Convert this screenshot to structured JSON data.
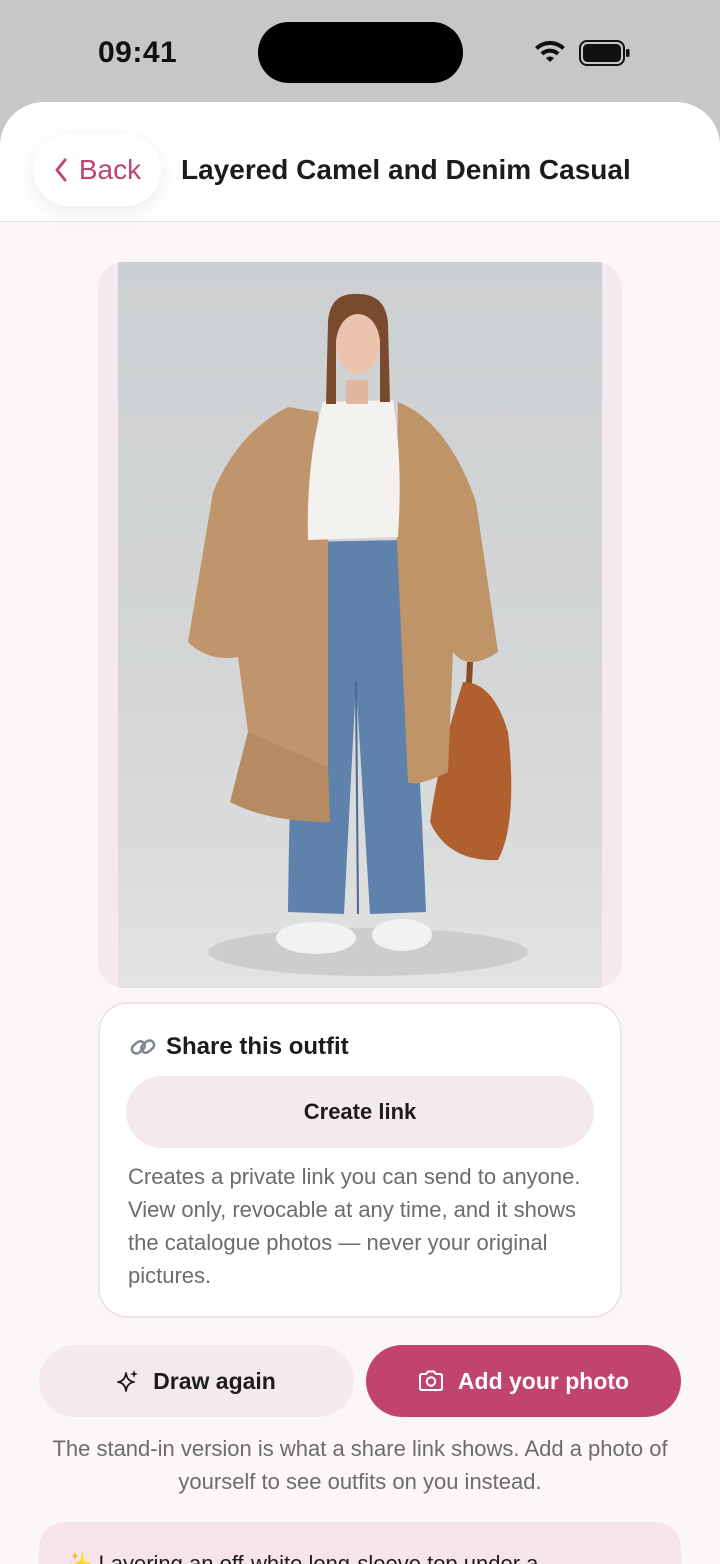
{
  "status": {
    "time": "09:41"
  },
  "nav": {
    "back_label": "Back",
    "title": "Layered Camel and Denim Casual"
  },
  "outfit_image": {
    "alt": "Outfit photo: camel overcoat, white long-sleeve top, wide-leg jeans, white sneakers, brown tote"
  },
  "share": {
    "heading": "Share this outfit",
    "create_link_label": "Create link",
    "description": "Creates a private link you can send to anyone. View only, revocable at any time, and it shows the catalogue photos — never your original pictures."
  },
  "actions": {
    "draw_again_label": "Draw again",
    "add_photo_label": "Add your photo"
  },
  "hint": "The stand-in version is what a share link shows. Add a photo of yourself to see outfits on you instead.",
  "tip": {
    "text": "✨ Layering an off-white long-sleeve top under a"
  },
  "colors": {
    "accent": "#c0446e",
    "back_text": "#c0456e",
    "soft_pink": "#f4e9ef"
  }
}
